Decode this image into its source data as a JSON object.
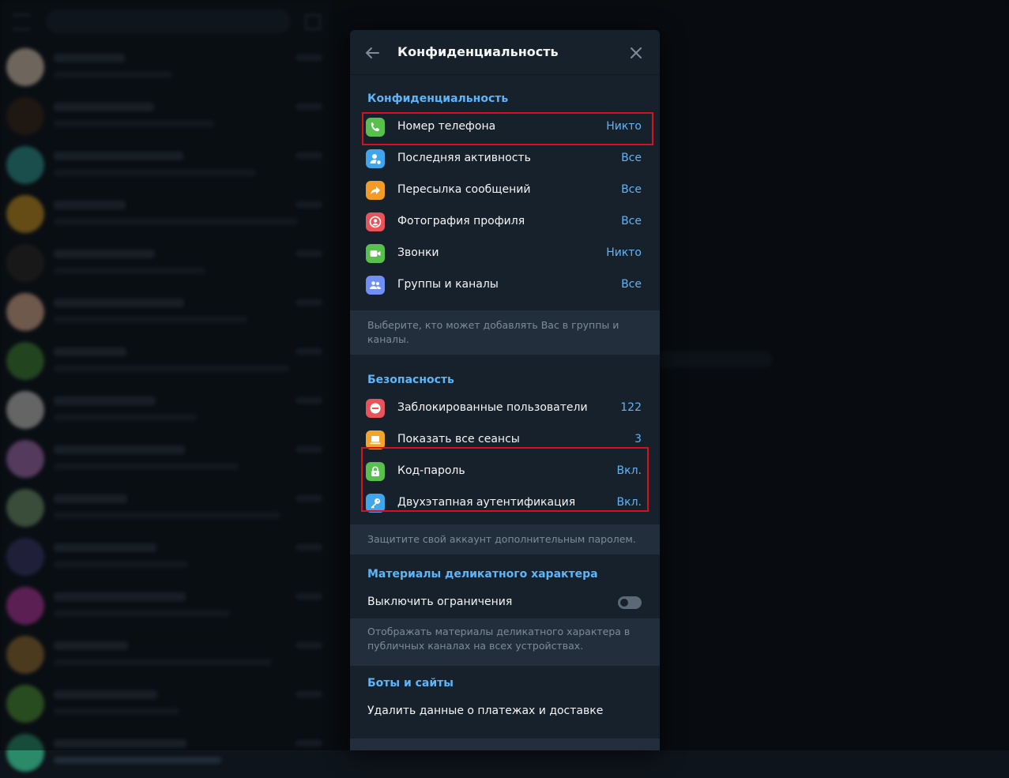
{
  "modal": {
    "title": "Конфиденциальность",
    "privacy": {
      "heading": "Конфиденциальность",
      "items": [
        {
          "label": "Номер телефона",
          "value": "Никто",
          "icon": "phone-icon",
          "color": "#58c04c"
        },
        {
          "label": "Последняя активность",
          "value": "Все",
          "icon": "user-status-icon",
          "color": "#3fa6ec"
        },
        {
          "label": "Пересылка сообщений",
          "value": "Все",
          "icon": "forward-icon",
          "color": "#f29b26"
        },
        {
          "label": "Фотография профиля",
          "value": "Все",
          "icon": "profile-photo-icon",
          "color": "#e9545a"
        },
        {
          "label": "Звонки",
          "value": "Никто",
          "icon": "video-call-icon",
          "color": "#58c04c"
        },
        {
          "label": "Группы и каналы",
          "value": "Все",
          "icon": "groups-icon",
          "color": "#6f8ff4"
        }
      ],
      "note": "Выберите, кто может добавлять Вас в группы и каналы."
    },
    "security": {
      "heading": "Безопасность",
      "items": [
        {
          "label": "Заблокированные пользователи",
          "value": "122",
          "icon": "blocked-icon",
          "color": "#e9545a"
        },
        {
          "label": "Показать все сеансы",
          "value": "3",
          "icon": "laptop-icon",
          "color": "#f2a529"
        },
        {
          "label": "Код-пароль",
          "value": "Вкл.",
          "icon": "lock-icon",
          "color": "#58c04c"
        },
        {
          "label": "Двухэтапная аутентификация",
          "value": "Вкл.",
          "icon": "key-icon",
          "color": "#3fa6ec"
        }
      ],
      "note": "Защитите свой аккаунт дополнительным паролем."
    },
    "sensitive": {
      "heading": "Материалы деликатного характера",
      "toggle_label": "Выключить ограничения",
      "toggle_on": false,
      "note_line1": "Отображать материалы деликатного характера в",
      "note_line2": "публичных каналах на всех устройствах."
    },
    "bots": {
      "heading": "Боты и сайты",
      "item": "Удалить данные о платежах и доставке"
    }
  },
  "colors": {
    "accent": "#5eb5f7",
    "highlight": "#d90f1a",
    "panel": "#17212b",
    "note_bg": "#232e3c"
  }
}
